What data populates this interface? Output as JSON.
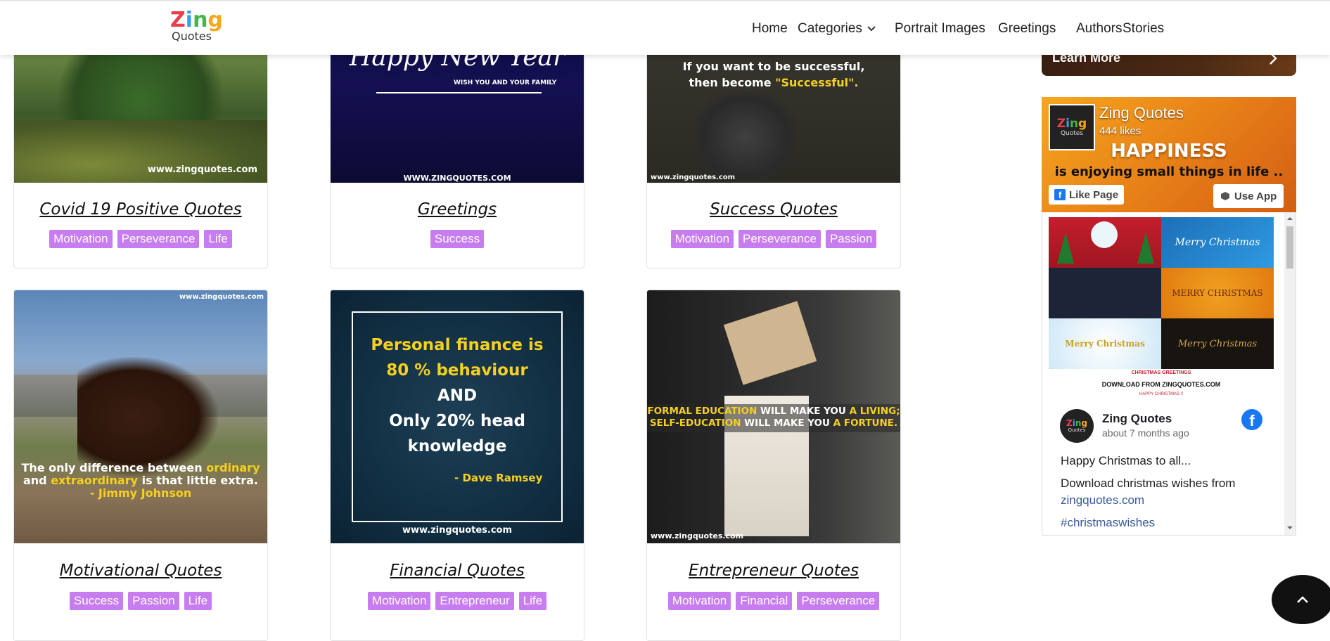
{
  "brand": {
    "logo_line1": "Zing",
    "logo_line2": "Quotes"
  },
  "nav": {
    "items": [
      "Home",
      "Categories",
      "Portrait Images",
      "Greetings",
      "Authors",
      "Stories"
    ]
  },
  "cards": [
    {
      "title": "Covid 19 Positive Quotes",
      "tags": [
        "Motivation",
        "Perseverance",
        "Life"
      ],
      "watermark": "www.zingquotes.com"
    },
    {
      "title": "Greetings",
      "tags": [
        "Success"
      ],
      "image_text": {
        "heading": "Happy New Year",
        "sub": "WISH YOU AND YOUR FAMILY",
        "watermark": "WWW.ZINGQUOTES.COM"
      }
    },
    {
      "title": "Success Quotes",
      "tags": [
        "Motivation",
        "Perseverance",
        "Passion"
      ],
      "image_text": {
        "line1": "If you want to be successful,",
        "line2_a": "then become ",
        "line2_b": "\"Successful\".",
        "watermark": "www.zingquotes.com"
      }
    },
    {
      "title": "Motivational Quotes",
      "tags": [
        "Success",
        "Passion",
        "Life"
      ],
      "image_text": {
        "watermark": "www.zingquotes.com",
        "l1a": "The only difference between ",
        "l1b": "ordinary",
        "l2a": "and ",
        "l2b": "extraordinary",
        "l2c": " is that little extra.",
        "l3": "- Jimmy Johnson"
      }
    },
    {
      "title": "Financial Quotes",
      "tags": [
        "Motivation",
        "Entrepreneur",
        "Life"
      ],
      "image_text": {
        "l1": "Personal finance is",
        "l2": "80 % behaviour",
        "l3": "AND",
        "l4": "Only 20% head",
        "l5": "knowledge",
        "author": "- Dave Ramsey",
        "watermark": "www.zingquotes.com"
      }
    },
    {
      "title": "Entrepreneur Quotes",
      "tags": [
        "Motivation",
        "Financial",
        "Perseverance"
      ],
      "image_text": {
        "l1a": "FORMAL EDUCATION",
        "l1b": " WILL MAKE YOU ",
        "l1c": "A LIVING;",
        "l2a": "SELF-EDUCATION",
        "l2b": " WILL MAKE YOU ",
        "l2c": "A FORTUNE.",
        "watermark": "www.zingquotes.com"
      }
    }
  ],
  "ad": {
    "label": "Learn More"
  },
  "facebook": {
    "page_name": "Zing Quotes",
    "likes": "444 likes",
    "cover_line1": "HAPPINESS",
    "cover_line2": "is enjoying small things in life ..",
    "like_button": "Like Page",
    "app_button": "Use App",
    "post_author": "Zing Quotes",
    "post_time": "about 7 months ago",
    "post_text1": "Happy Christmas to all...",
    "post_text2": "Download christmas wishes from",
    "post_link": "zingquotes.com",
    "post_hashtag": "#christmaswishes",
    "grid_caption1": "CHRISTMAS GREETINGS",
    "grid_caption2": "DOWNLOAD FROM ZINGQUOTES.COM",
    "grid_caption3": "HAPPY CHRISTMAS !!",
    "grid_labels": [
      "Merry Christmas",
      "MERRY CHRISTMAS",
      "Merry Christmas",
      "Merry Christmas"
    ],
    "colors": {
      "fb_blue": "#1877f2",
      "link": "#385898"
    }
  },
  "colors": {
    "tag_bg": "#c77cf0",
    "tag_text": "#ffffff",
    "scroll_btn": "#111111"
  }
}
